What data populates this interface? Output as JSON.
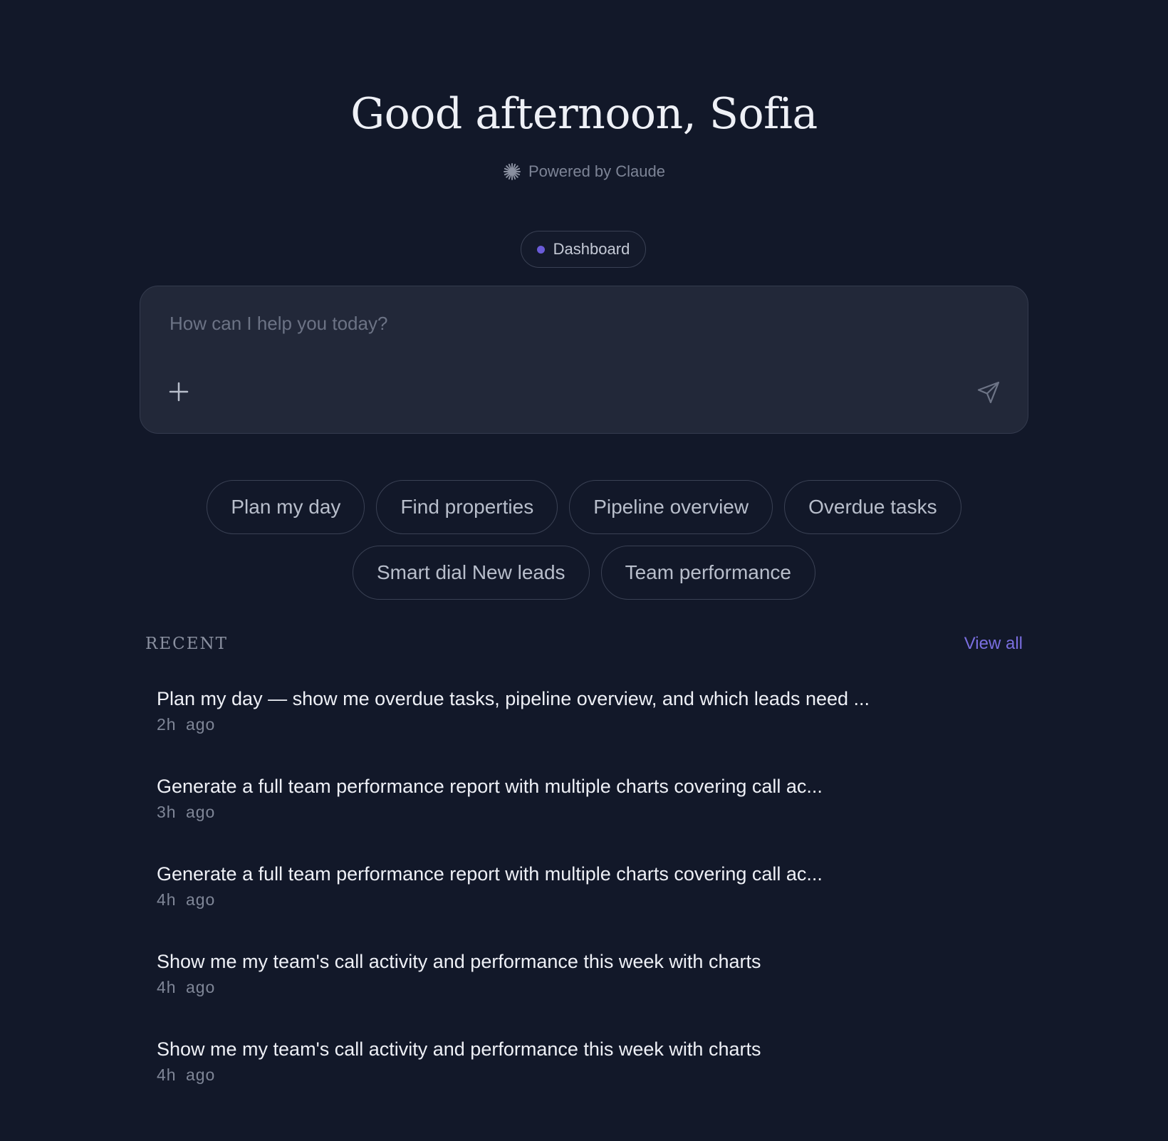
{
  "greeting": "Good afternoon, Sofia",
  "powered_by": {
    "icon": "claude-spark-icon",
    "label": "Powered by Claude"
  },
  "context_pill": {
    "label": "Dashboard",
    "dot_color": "#6a5bd8"
  },
  "composer": {
    "placeholder": "How can I help you today?",
    "value": "",
    "attach_icon": "plus-icon",
    "send_icon": "send-icon"
  },
  "suggestions": {
    "row1": [
      {
        "label": "Plan my day"
      },
      {
        "label": "Find properties"
      },
      {
        "label": "Pipeline overview"
      },
      {
        "label": "Overdue tasks"
      }
    ],
    "row2": [
      {
        "label": "Smart dial New leads"
      },
      {
        "label": "Team performance"
      }
    ]
  },
  "recent": {
    "heading": "RECENT",
    "view_all": "View all",
    "items": [
      {
        "title": "Plan my day — show me overdue tasks, pipeline overview, and which leads need ...",
        "time": "2h ago"
      },
      {
        "title": "Generate a full team performance report with multiple charts covering call ac...",
        "time": "3h ago"
      },
      {
        "title": "Generate a full team performance report with multiple charts covering call ac...",
        "time": "4h ago"
      },
      {
        "title": "Show me my team's call activity and performance this week with charts",
        "time": "4h ago"
      },
      {
        "title": "Show me my team's call activity and performance this week with charts",
        "time": "4h ago"
      }
    ]
  },
  "colors": {
    "background": "#121829",
    "accent": "#7a6ee0",
    "composer_bg": "#222839"
  }
}
